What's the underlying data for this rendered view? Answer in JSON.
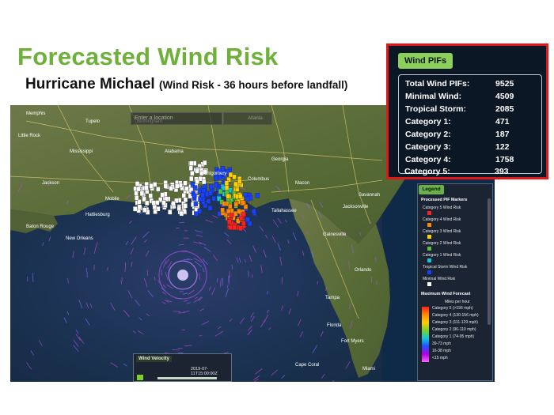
{
  "slide": {
    "title": "Forecasted Wind Risk",
    "subtitle_main": "Hurricane Michael ",
    "subtitle_detail": "(Wind Risk - 36 hours before landfall)"
  },
  "map": {
    "search_placeholder": "Enter a location",
    "place_labels": [
      "Memphis",
      "Little Rock",
      "Tupelo",
      "Birmingham",
      "Atlanta",
      "Mississippi",
      "Alabama",
      "Georgia",
      "Montgomery",
      "Columbus",
      "Macon",
      "Savannah",
      "Jackson",
      "Hattiesburg",
      "Baton Rouge",
      "New Orleans",
      "Mobile",
      "Tallahassee",
      "Jacksonville",
      "Gainesville",
      "Orlando",
      "Tampa",
      "Fort Myers",
      "Miami",
      "Florida",
      "Cape Coral"
    ],
    "colors": {
      "sea": "#142c44",
      "land": "#5b6b3a",
      "white_markers": "#ffffff",
      "cat5": "#ff2020",
      "cat4": "#ff8a00",
      "cat3": "#ffd000",
      "cat2": "#55c23a",
      "cat1": "#12c8d8",
      "ts": "#1840ff"
    }
  },
  "wind_pifs": {
    "tab_label": "Wind PIFs",
    "rows": [
      {
        "label": "Total Wind PIFs:",
        "value": "9525"
      },
      {
        "label": "Minimal Wind:",
        "value": "4509"
      },
      {
        "label": "Tropical Storm:",
        "value": "2085"
      },
      {
        "label": "Category 1:",
        "value": "471"
      },
      {
        "label": "Category 2:",
        "value": "187"
      },
      {
        "label": "Category 3:",
        "value": "122"
      },
      {
        "label": "Category 4:",
        "value": "1758"
      },
      {
        "label": "Category 5:",
        "value": "393"
      }
    ]
  },
  "legend": {
    "tab_label": "Legend",
    "section_pif": "Processed PIF Markers",
    "pif_items": [
      {
        "label": "Category 5 Wind Risk",
        "color": "#ff2020"
      },
      {
        "label": "Category 4 Wind Risk",
        "color": "#ff8a00"
      },
      {
        "label": "Category 3 Wind Risk",
        "color": "#ffd000"
      },
      {
        "label": "Category 2 Wind Risk",
        "color": "#55c23a"
      },
      {
        "label": "Category 1 Wind Risk",
        "color": "#12c8d8"
      },
      {
        "label": "Tropical Storm Wind Risk",
        "color": "#1840ff"
      },
      {
        "label": "Minimal Wind Risk",
        "color": "#ffffff"
      }
    ],
    "section_forecast": "Maximum Wind Forecast",
    "forecast_unit": "Miles per hour",
    "forecast_items": [
      "Category 5 (>156 mph)",
      "Category 4 (130-156 mph)",
      "Category 3 (111-129 mph)",
      "Category 2 (96-110 mph)",
      "Category 1 (74-95 mph)",
      "39-73 mph",
      "16-38 mph",
      "<15 mph"
    ]
  },
  "wind_velocity": {
    "tab_label": "Wind Velocity",
    "timestamp": "2019-07-11T15:00:00Z"
  }
}
